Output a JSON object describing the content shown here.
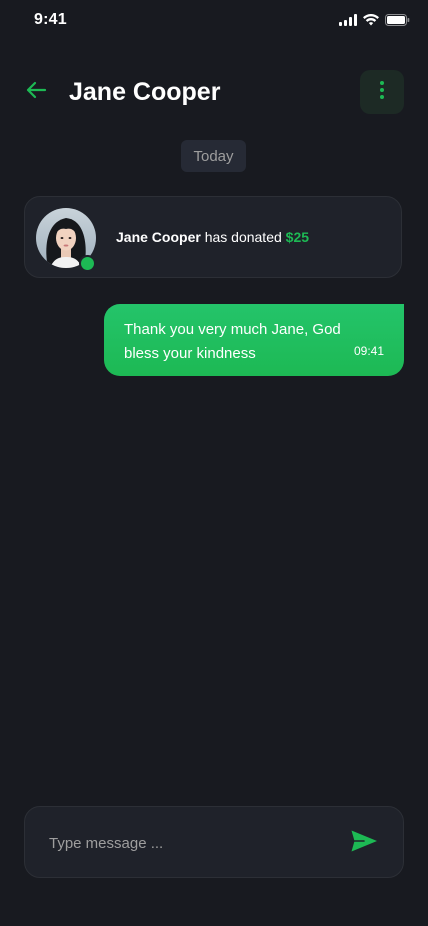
{
  "status_bar": {
    "time": "9:41",
    "icons": [
      "signal-icon",
      "wifi-icon",
      "battery-icon"
    ]
  },
  "header": {
    "title": "Jane Cooper",
    "back_icon": "arrow-left-icon",
    "more_icon": "more-vertical-icon"
  },
  "chat": {
    "date_label": "Today",
    "donation": {
      "name": "Jane Cooper",
      "text": " has donated ",
      "amount": "$25",
      "online": true
    },
    "messages": [
      {
        "direction": "outgoing",
        "text": "Thank you very much Jane, God bless your kindness",
        "time": "09:41"
      }
    ]
  },
  "composer": {
    "placeholder": "Type message ...",
    "value": "",
    "send_icon": "send-icon"
  },
  "colors": {
    "background": "#181A20",
    "surface": "#1F222A",
    "accent": "#1DB954",
    "muted_text": "#9E9E9E",
    "date_chip": "#262A35"
  }
}
